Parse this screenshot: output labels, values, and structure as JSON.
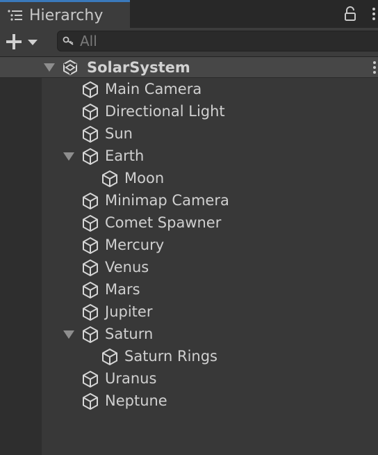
{
  "tab": {
    "label": "Hierarchy",
    "icon": "hierarchy-list-icon"
  },
  "toolbar": {
    "create_icon": "plus-dropdown-icon",
    "search_placeholder": "All",
    "search_icon": "search-icon"
  },
  "scene": {
    "name": "SolarSystem",
    "icon": "unity-logo-icon",
    "expanded": true
  },
  "objects": [
    {
      "name": "Main Camera",
      "depth": 0,
      "expandable": false
    },
    {
      "name": "Directional Light",
      "depth": 0,
      "expandable": false
    },
    {
      "name": "Sun",
      "depth": 0,
      "expandable": false
    },
    {
      "name": "Earth",
      "depth": 0,
      "expandable": true,
      "expanded": true
    },
    {
      "name": "Moon",
      "depth": 1,
      "expandable": false
    },
    {
      "name": "Minimap Camera",
      "depth": 0,
      "expandable": false
    },
    {
      "name": "Comet Spawner",
      "depth": 0,
      "expandable": false
    },
    {
      "name": "Mercury",
      "depth": 0,
      "expandable": false
    },
    {
      "name": "Venus",
      "depth": 0,
      "expandable": false
    },
    {
      "name": "Mars",
      "depth": 0,
      "expandable": false
    },
    {
      "name": "Jupiter",
      "depth": 0,
      "expandable": false
    },
    {
      "name": "Saturn",
      "depth": 0,
      "expandable": true,
      "expanded": true
    },
    {
      "name": "Saturn Rings",
      "depth": 1,
      "expandable": false
    },
    {
      "name": "Uranus",
      "depth": 0,
      "expandable": false
    },
    {
      "name": "Neptune",
      "depth": 0,
      "expandable": false
    }
  ],
  "colors": {
    "accent": "#3a79bb",
    "background": "#383838",
    "text": "#d0d0d0"
  }
}
